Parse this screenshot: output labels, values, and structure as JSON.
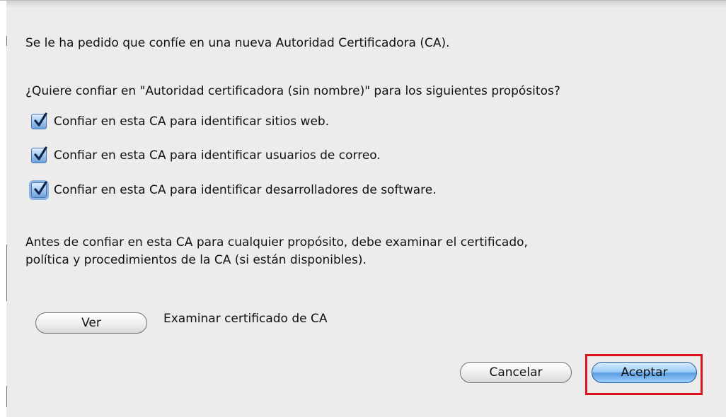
{
  "dialog": {
    "intro": "Se le ha pedido que confíe en una nueva Autoridad Certificadora (CA).",
    "question": "¿Quiere confiar en \"Autoridad certificadora (sin nombre)\" para los siguientes propósitos?",
    "options": [
      {
        "label": "Confiar en esta CA para identificar sitios web.",
        "checked": true
      },
      {
        "label": "Confiar en esta CA para identificar usuarios de correo.",
        "checked": true
      },
      {
        "label": "Confiar en esta CA para identificar desarrolladores de software.",
        "checked": true
      }
    ],
    "warning_line1": "Antes de confiar en esta CA para cualquier propósito, debe examinar el certificado,",
    "warning_line2": "política y procedimientos de la CA (si están disponibles).",
    "view_button": "Ver",
    "view_description": "Examinar certificado de CA",
    "cancel_button": "Cancelar",
    "accept_button": "Aceptar"
  },
  "colors": {
    "highlight": "#e0141e",
    "default_button": "#5c9fe3",
    "checkbox": "#6ea1d8"
  }
}
